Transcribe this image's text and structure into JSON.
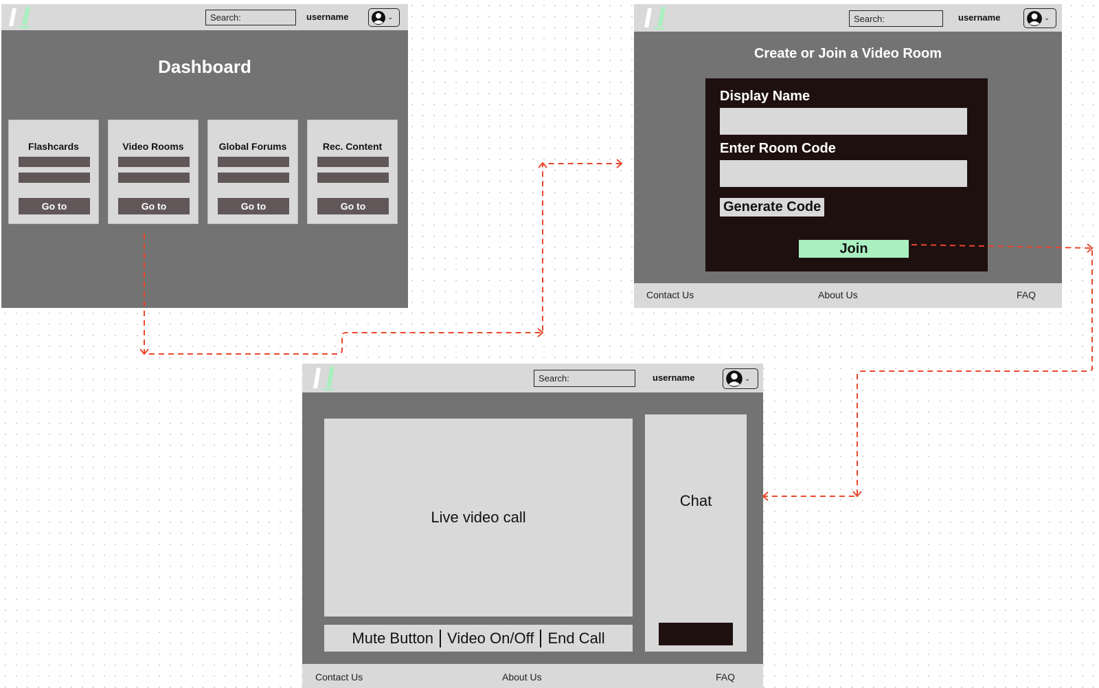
{
  "header": {
    "search_label": "Search:",
    "username": "username",
    "logo_colors": [
      "#ffffff",
      "#a9efc0"
    ]
  },
  "dashboard": {
    "title": "Dashboard",
    "cards": [
      {
        "title": "Flashcards",
        "button": "Go to"
      },
      {
        "title": "Video Rooms",
        "button": "Go to"
      },
      {
        "title": "Global Forums",
        "button": "Go to"
      },
      {
        "title": "Rec. Content",
        "button": "Go to"
      }
    ]
  },
  "video_room_setup": {
    "title": "Create or Join a Video Room",
    "display_name_label": "Display Name",
    "room_code_label": "Enter Room Code",
    "generate_button": "Generate Code",
    "join_button": "Join"
  },
  "video_call": {
    "video_label": "Live video call",
    "controls": [
      "Mute Button",
      "Video On/Off",
      "End Call"
    ],
    "chat_label": "Chat"
  },
  "footer": {
    "contact": "Contact Us",
    "about": "About Us",
    "faq": "FAQ"
  },
  "colors": {
    "frame": "#737373",
    "bar": "#d9d9d9",
    "dark_panel": "#1f1010",
    "join_green": "#a9efc0",
    "arrow": "#e8462a"
  }
}
